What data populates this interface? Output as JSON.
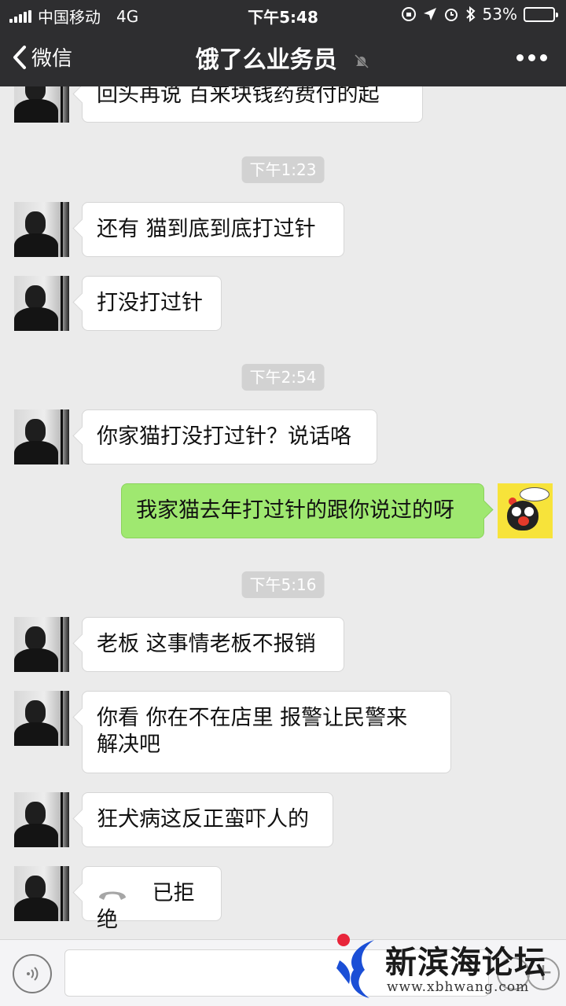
{
  "status_bar": {
    "carrier": "中国移动",
    "network": "4G",
    "time": "下午5:48",
    "battery": "53%",
    "battery_level": 0.53
  },
  "nav": {
    "back_label": "微信",
    "title": "饿了么业务员"
  },
  "messages": {
    "m0": "回头再说   百来块钱药费付的起",
    "ts1": "下午1:23",
    "m1": "还有  猫到底到底打过针",
    "m2": "打没打过针",
    "ts2": "下午2:54",
    "m3": "你家猫打没打过针？说话咯",
    "m4": "我家猫去年打过针的跟你说过的呀",
    "ts3": "下午5:16",
    "m5": "老板  这事情老板不报销",
    "m6_line1": "你看  你在不在店里   报警让民警来",
    "m6_line2": "解决吧",
    "m7": "狂犬病这反正蛮吓人的",
    "m8": "已拒绝"
  },
  "watermark": {
    "title": "新滨海论坛",
    "url": "www.xbhwang.com"
  },
  "colors": {
    "header_bg": "#2e2e30",
    "chat_bg": "#ebebeb",
    "my_bubble": "#9fe870",
    "their_bubble": "#ffffff"
  }
}
